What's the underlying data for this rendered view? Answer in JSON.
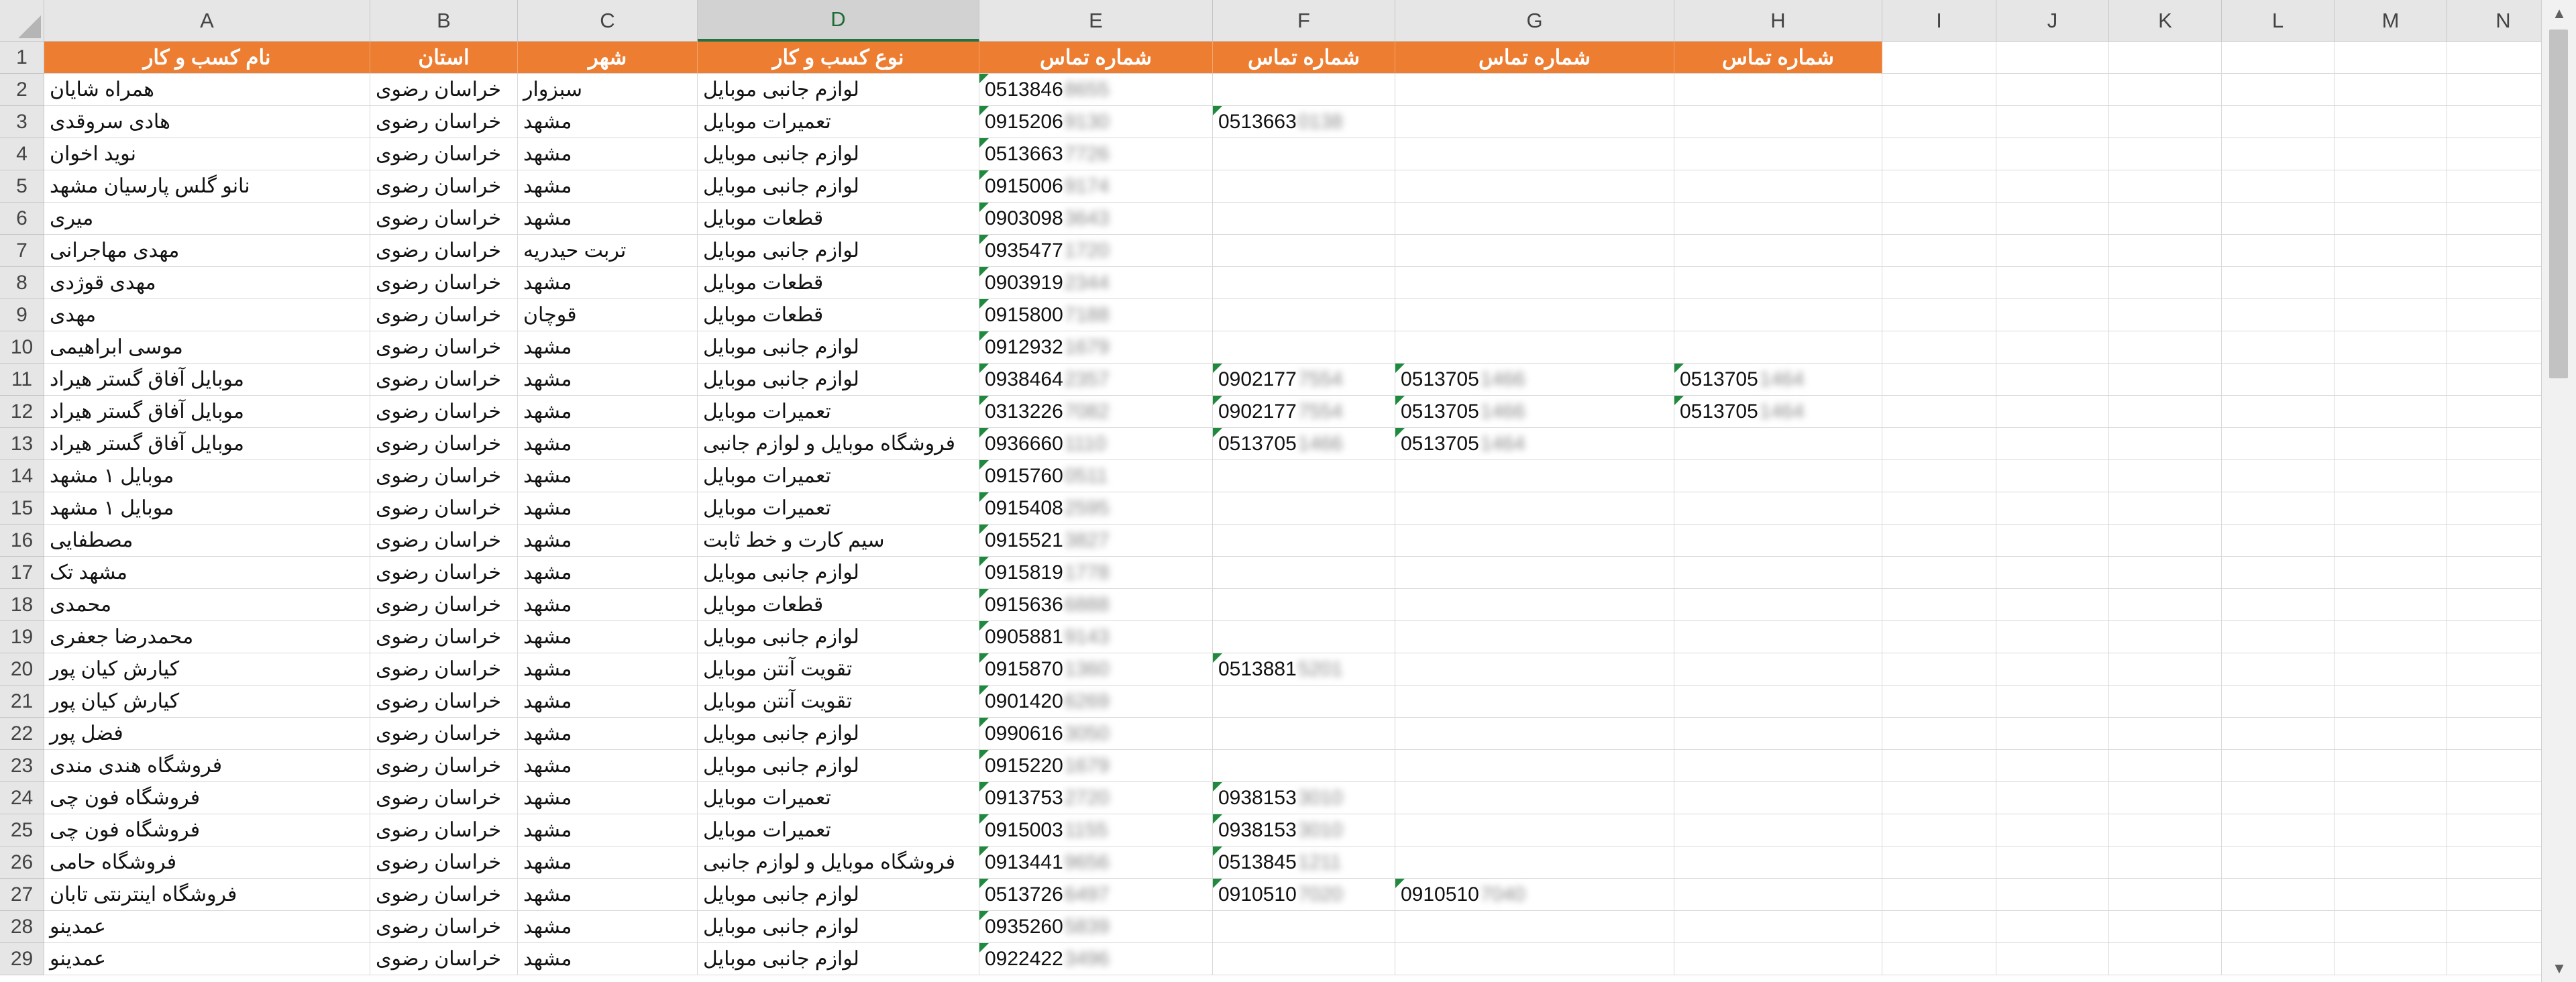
{
  "columns": [
    "A",
    "B",
    "C",
    "D",
    "E",
    "F",
    "G",
    "H",
    "I",
    "J",
    "K",
    "L",
    "M",
    "N"
  ],
  "selected_column": "D",
  "header_color": "#ed7d31",
  "accent_color": "#217346",
  "headers": [
    "نام کسب و کار",
    "استان",
    "شهر",
    "نوع کسب و کار",
    "شماره تماس",
    "شماره تماس",
    "شماره تماس",
    "شماره تماس"
  ],
  "rows": [
    {
      "num": "2",
      "name": "همراه شایان",
      "province": "خراسان رضوی",
      "city": "سبزوار",
      "type": "لوازم جانبی موبایل",
      "p1": "0513846",
      "p1h": "8655",
      "p2": "",
      "p2h": "",
      "p3": "",
      "p3h": "",
      "p4": "",
      "p4h": ""
    },
    {
      "num": "3",
      "name": "هادی سروقدی",
      "province": "خراسان رضوی",
      "city": "مشهد",
      "type": "تعمیرات موبایل",
      "p1": "0915206",
      "p1h": "9130",
      "p2": "0513663",
      "p2h": "0138",
      "p3": "",
      "p3h": "",
      "p4": "",
      "p4h": ""
    },
    {
      "num": "4",
      "name": "نوید اخوان",
      "province": "خراسان رضوی",
      "city": "مشهد",
      "type": "لوازم جانبی موبایل",
      "p1": "0513663",
      "p1h": "7726",
      "p2": "",
      "p2h": "",
      "p3": "",
      "p3h": "",
      "p4": "",
      "p4h": ""
    },
    {
      "num": "5",
      "name": "نانو گلس پارسیان مشهد",
      "province": "خراسان رضوی",
      "city": "مشهد",
      "type": "لوازم جانبی موبایل",
      "p1": "0915006",
      "p1h": "9174",
      "p2": "",
      "p2h": "",
      "p3": "",
      "p3h": "",
      "p4": "",
      "p4h": ""
    },
    {
      "num": "6",
      "name": "میری",
      "province": "خراسان رضوی",
      "city": "مشهد",
      "type": "قطعات موبایل",
      "p1": "0903098",
      "p1h": "3643",
      "p2": "",
      "p2h": "",
      "p3": "",
      "p3h": "",
      "p4": "",
      "p4h": ""
    },
    {
      "num": "7",
      "name": "مهدی مهاجرانی",
      "province": "خراسان رضوی",
      "city": "تربت حیدریه",
      "type": "لوازم جانبی موبایل",
      "p1": "0935477",
      "p1h": "1720",
      "p2": "",
      "p2h": "",
      "p3": "",
      "p3h": "",
      "p4": "",
      "p4h": ""
    },
    {
      "num": "8",
      "name": "مهدی قوژدی",
      "province": "خراسان رضوی",
      "city": "مشهد",
      "type": "قطعات موبایل",
      "p1": "0903919",
      "p1h": "2344",
      "p2": "",
      "p2h": "",
      "p3": "",
      "p3h": "",
      "p4": "",
      "p4h": ""
    },
    {
      "num": "9",
      "name": "مهدی",
      "province": "خراسان رضوی",
      "city": "قوچان",
      "type": "قطعات موبایل",
      "p1": "0915800",
      "p1h": "7188",
      "p2": "",
      "p2h": "",
      "p3": "",
      "p3h": "",
      "p4": "",
      "p4h": ""
    },
    {
      "num": "10",
      "name": "موسی ابراهیمی",
      "province": "خراسان رضوی",
      "city": "مشهد",
      "type": "لوازم جانبی موبایل",
      "p1": "0912932",
      "p1h": "1679",
      "p2": "",
      "p2h": "",
      "p3": "",
      "p3h": "",
      "p4": "",
      "p4h": ""
    },
    {
      "num": "11",
      "name": "موبایل آفاق گستر هیراد",
      "province": "خراسان رضوی",
      "city": "مشهد",
      "type": "لوازم جانبی موبایل",
      "p1": "0938464",
      "p1h": "2357",
      "p2": "0902177",
      "p2h": "7554",
      "p3": "0513705",
      "p3h": "1466",
      "p4": "0513705",
      "p4h": "1464"
    },
    {
      "num": "12",
      "name": "موبایل آفاق گستر هیراد",
      "province": "خراسان رضوی",
      "city": "مشهد",
      "type": "تعمیرات موبایل",
      "p1": "0313226",
      "p1h": "7082",
      "p2": "0902177",
      "p2h": "7554",
      "p3": "0513705",
      "p3h": "1466",
      "p4": "0513705",
      "p4h": "1464"
    },
    {
      "num": "13",
      "name": "موبایل آفاق گستر هیراد",
      "province": "خراسان رضوی",
      "city": "مشهد",
      "type": "فروشگاه موبایل و لوازم جانبی",
      "p1": "0936660",
      "p1h": "1110",
      "p2": "0513705",
      "p2h": "1466",
      "p3": "0513705",
      "p3h": "1464",
      "p4": "",
      "p4h": ""
    },
    {
      "num": "14",
      "name": "موبایل ۱ مشهد",
      "province": "خراسان رضوی",
      "city": "مشهد",
      "type": "تعمیرات موبایل",
      "p1": "0915760",
      "p1h": "0511",
      "p2": "",
      "p2h": "",
      "p3": "",
      "p3h": "",
      "p4": "",
      "p4h": ""
    },
    {
      "num": "15",
      "name": "موبایل ۱ مشهد",
      "province": "خراسان رضوی",
      "city": "مشهد",
      "type": "تعمیرات موبایل",
      "p1": "0915408",
      "p1h": "2595",
      "p2": "",
      "p2h": "",
      "p3": "",
      "p3h": "",
      "p4": "",
      "p4h": ""
    },
    {
      "num": "16",
      "name": "مصطفایی",
      "province": "خراسان رضوی",
      "city": "مشهد",
      "type": "سیم کارت و خط ثابت",
      "p1": "0915521",
      "p1h": "3827",
      "p2": "",
      "p2h": "",
      "p3": "",
      "p3h": "",
      "p4": "",
      "p4h": ""
    },
    {
      "num": "17",
      "name": "مشهد تک",
      "province": "خراسان رضوی",
      "city": "مشهد",
      "type": "لوازم جانبی موبایل",
      "p1": "0915819",
      "p1h": "1778",
      "p2": "",
      "p2h": "",
      "p3": "",
      "p3h": "",
      "p4": "",
      "p4h": ""
    },
    {
      "num": "18",
      "name": "محمدی",
      "province": "خراسان رضوی",
      "city": "مشهد",
      "type": "قطعات موبایل",
      "p1": "0915636",
      "p1h": "6888",
      "p2": "",
      "p2h": "",
      "p3": "",
      "p3h": "",
      "p4": "",
      "p4h": ""
    },
    {
      "num": "19",
      "name": "محمدرضا جعفری",
      "province": "خراسان رضوی",
      "city": "مشهد",
      "type": "لوازم جانبی موبایل",
      "p1": "0905881",
      "p1h": "9143",
      "p2": "",
      "p2h": "",
      "p3": "",
      "p3h": "",
      "p4": "",
      "p4h": ""
    },
    {
      "num": "20",
      "name": "کیارش کیان پور",
      "province": "خراسان رضوی",
      "city": "مشهد",
      "type": "تقویت آنتن موبایل",
      "p1": "0915870",
      "p1h": "1360",
      "p2": "0513881",
      "p2h": "5201",
      "p3": "",
      "p3h": "",
      "p4": "",
      "p4h": ""
    },
    {
      "num": "21",
      "name": "کیارش کیان پور",
      "province": "خراسان رضوی",
      "city": "مشهد",
      "type": "تقویت آنتن موبایل",
      "p1": "0901420",
      "p1h": "6269",
      "p2": "",
      "p2h": "",
      "p3": "",
      "p3h": "",
      "p4": "",
      "p4h": ""
    },
    {
      "num": "22",
      "name": "فضل پور",
      "province": "خراسان رضوی",
      "city": "مشهد",
      "type": "لوازم جانبی موبایل",
      "p1": "0990616",
      "p1h": "3050",
      "p2": "",
      "p2h": "",
      "p3": "",
      "p3h": "",
      "p4": "",
      "p4h": ""
    },
    {
      "num": "23",
      "name": "فروشگاه هندی مندی",
      "province": "خراسان رضوی",
      "city": "مشهد",
      "type": "لوازم جانبی موبایل",
      "p1": "0915220",
      "p1h": "1679",
      "p2": "",
      "p2h": "",
      "p3": "",
      "p3h": "",
      "p4": "",
      "p4h": ""
    },
    {
      "num": "24",
      "name": "فروشگاه فون چی",
      "province": "خراسان رضوی",
      "city": "مشهد",
      "type": "تعمیرات موبایل",
      "p1": "0913753",
      "p1h": "2720",
      "p2": "0938153",
      "p2h": "3010",
      "p3": "",
      "p3h": "",
      "p4": "",
      "p4h": ""
    },
    {
      "num": "25",
      "name": "فروشگاه فون چی",
      "province": "خراسان رضوی",
      "city": "مشهد",
      "type": "تعمیرات موبایل",
      "p1": "0915003",
      "p1h": "1155",
      "p2": "0938153",
      "p2h": "3010",
      "p3": "",
      "p3h": "",
      "p4": "",
      "p4h": ""
    },
    {
      "num": "26",
      "name": "فروشگاه حامی",
      "province": "خراسان رضوی",
      "city": "مشهد",
      "type": "فروشگاه موبایل و لوازم جانبی",
      "p1": "0913441",
      "p1h": "9656",
      "p2": "0513845",
      "p2h": "1211",
      "p3": "",
      "p3h": "",
      "p4": "",
      "p4h": ""
    },
    {
      "num": "27",
      "name": "فروشگاه اینترنتی تابان",
      "province": "خراسان رضوی",
      "city": "مشهد",
      "type": "لوازم جانبی موبایل",
      "p1": "0513726",
      "p1h": "6497",
      "p2": "0910510",
      "p2h": "7020",
      "p3": "0910510",
      "p3h": "7040",
      "p4": "",
      "p4h": ""
    },
    {
      "num": "28",
      "name": "عمدینو",
      "province": "خراسان رضوی",
      "city": "مشهد",
      "type": "لوازم جانبی موبایل",
      "p1": "0935260",
      "p1h": "5839",
      "p2": "",
      "p2h": "",
      "p3": "",
      "p3h": "",
      "p4": "",
      "p4h": ""
    },
    {
      "num": "29",
      "name": "عمدینو",
      "province": "خراسان رضوی",
      "city": "مشهد",
      "type": "لوازم جانبی موبایل",
      "p1": "0922422",
      "p1h": "3496",
      "p2": "",
      "p2h": "",
      "p3": "",
      "p3h": "",
      "p4": "",
      "p4h": ""
    }
  ],
  "scrollbar": {
    "up_icon": "arrow-up-icon",
    "down_icon": "arrow-down-icon",
    "up_glyph": "▲",
    "down_glyph": "▼"
  }
}
